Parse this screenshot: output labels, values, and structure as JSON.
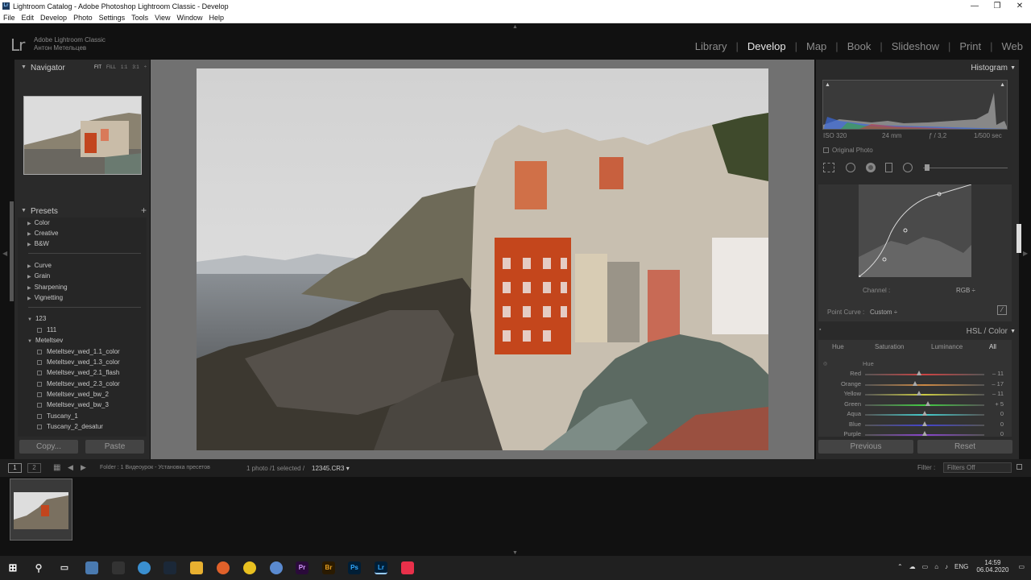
{
  "window": {
    "title": "Lightroom Catalog - Adobe Photoshop Lightroom Classic - Develop",
    "app_icon": "Lr"
  },
  "menu": [
    "File",
    "Edit",
    "Develop",
    "Photo",
    "Settings",
    "Tools",
    "View",
    "Window",
    "Help"
  ],
  "identity": {
    "logo": "Lr",
    "product": "Adobe Lightroom Classic",
    "user": "Антон Метельцев"
  },
  "modules": {
    "items": [
      "Library",
      "Develop",
      "Map",
      "Book",
      "Slideshow",
      "Print",
      "Web"
    ],
    "active": "Develop"
  },
  "navigator": {
    "title": "Navigator",
    "options": [
      "FIT",
      "FILL",
      "1:1",
      "3:1"
    ],
    "selected": "FIT"
  },
  "presets": {
    "title": "Presets",
    "add": "+",
    "groups1": [
      "Color",
      "Creative",
      "B&W"
    ],
    "groups2": [
      "Curve",
      "Grain",
      "Sharpening",
      "Vignetting"
    ],
    "user1": {
      "name": "123",
      "items": [
        "111"
      ]
    },
    "user2": {
      "name": "Meteltsev",
      "items": [
        "Meteltsev_wed_1.1_color",
        "Meteltsev_wed_1.3_color",
        "Meteltsev_wed_2.1_flash",
        "Meteltsev_wed_2.3_color",
        "Meteltsev_wed_bw_2",
        "Meteltsev_wed_bw_3",
        "Tuscany_1",
        "Tuscany_2_desatur"
      ]
    }
  },
  "left_buttons": {
    "copy": "Copy...",
    "paste": "Paste"
  },
  "histogram": {
    "title": "Histogram",
    "iso": "ISO 320",
    "focal": "24 mm",
    "aperture": "ƒ / 3,2",
    "shutter": "1/500 sec",
    "original": "Original Photo"
  },
  "tone_curve": {
    "channel_label": "Channel :",
    "channel_value": "RGB ÷",
    "point_curve_label": "Point Curve :",
    "point_curve_value": "Custom ÷"
  },
  "hsl": {
    "title": "HSL / Color",
    "tabs": [
      "Hue",
      "Saturation",
      "Luminance",
      "All"
    ],
    "active_tab": "All",
    "section": "Hue",
    "rows": [
      {
        "label": "Red",
        "value": "– 11",
        "pos": 0.45,
        "color": "#c44"
      },
      {
        "label": "Orange",
        "value": "– 17",
        "pos": 0.42,
        "color": "#c84"
      },
      {
        "label": "Yellow",
        "value": "– 11",
        "pos": 0.45,
        "color": "#cc4"
      },
      {
        "label": "Green",
        "value": "+ 5",
        "pos": 0.53,
        "color": "#4c4"
      },
      {
        "label": "Aqua",
        "value": "0",
        "pos": 0.5,
        "color": "#4cc"
      },
      {
        "label": "Blue",
        "value": "0",
        "pos": 0.5,
        "color": "#44c"
      },
      {
        "label": "Purple",
        "value": "0",
        "pos": 0.5,
        "color": "#84c"
      }
    ]
  },
  "right_buttons": {
    "previous": "Previous",
    "reset": "Reset"
  },
  "filmstrip": {
    "page1": "1",
    "page2": "2",
    "folder": "Folder : 1 Видеоурок - Установка пресетов",
    "count": "1 photo /1 selected /",
    "filename": "12345.CR3 ▾",
    "filter_label": "Filter :",
    "filter_value": "Filters Off"
  },
  "tray": {
    "lang": "ENG",
    "time": "14:59",
    "date": "06.04.2020"
  }
}
